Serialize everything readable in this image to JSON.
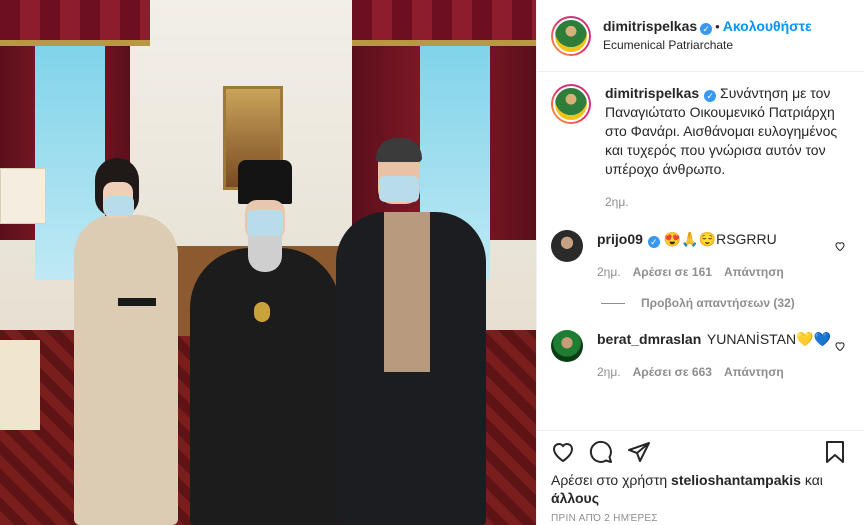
{
  "post": {
    "author": "dimitrispelkas",
    "follow_label": "Ακολουθήστε",
    "location": "Ecumenical Patriarchate",
    "caption": "Συνάντηση με τον Παναγιώτατο Οικουμενικό Πατριάρχη στο Φανάρι. Αισθάνομαι ευλογημένος και τυχερός που γνώρισα αυτόν τον υπέροχο άνθρωπο.",
    "caption_age": "2ημ."
  },
  "comments": [
    {
      "user": "prijo09",
      "verified": true,
      "text": "😍🙏😌RSGRRU",
      "age": "2ημ.",
      "likes": "Αρέσει σε 161",
      "reply": "Απάντηση",
      "view_replies": "Προβολή απαντήσεων (32)"
    },
    {
      "user": "berat_dmraslan",
      "verified": false,
      "text": "YUNANİSTAN💛💙",
      "age": "2ημ.",
      "likes": "Αρέσει σε 663",
      "reply": "Απάντηση"
    }
  ],
  "likes": {
    "prefix": "Αρέσει στο χρήστη",
    "user": "stelioshantampakis",
    "suffix": "και",
    "others": "άλλους"
  },
  "timestamp": "Πριν από 2 ημέρες",
  "icons": {
    "like": "heart-icon",
    "comment": "comment-icon",
    "share": "share-icon",
    "save": "bookmark-icon",
    "verified": "verified-badge-icon"
  },
  "colors": {
    "accent": "#0095f6",
    "verified": "#3897f0",
    "muted": "#8e8e8e",
    "text": "#262626"
  }
}
